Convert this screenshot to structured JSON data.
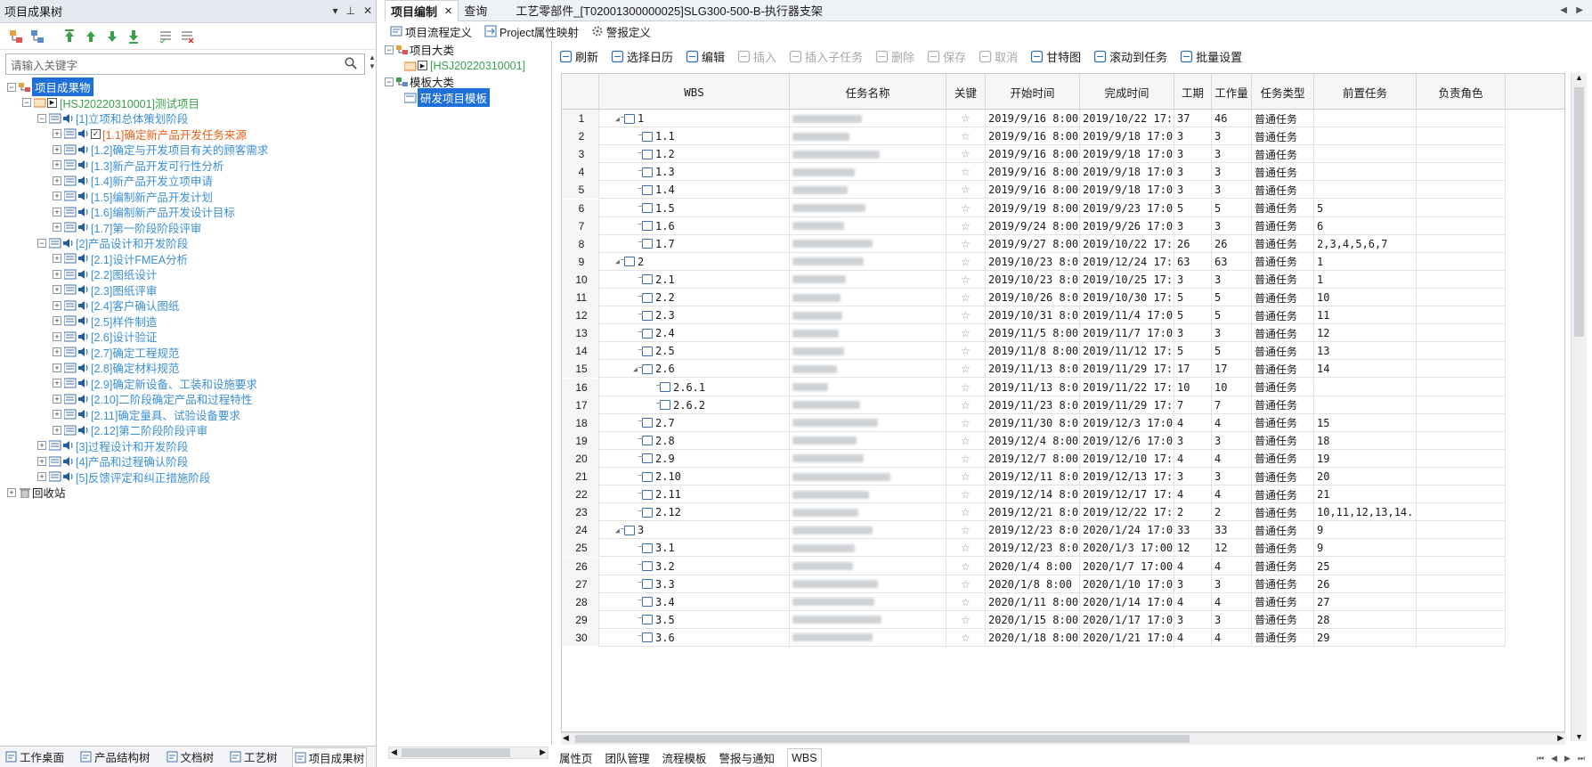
{
  "left_panel": {
    "title": "项目成果树",
    "search_placeholder": "请输入关键字",
    "tree": [
      {
        "label": "项目成果物",
        "selected": true
      },
      {
        "label": "[HSJ20220310001]测试项目",
        "color": "green"
      },
      {
        "label": "[1]立项和总体策划阶段"
      },
      {
        "label": "[1.1]确定新产品开发任务来源",
        "color": "orange"
      },
      {
        "label": "[1.2]确定与开发项目有关的顾客需求"
      },
      {
        "label": "[1.3]新产品开发可行性分析"
      },
      {
        "label": "[1.4]新产品开发立项申请"
      },
      {
        "label": "[1.5]编制新产品开发计划"
      },
      {
        "label": "[1.6]编制新产品开发设计目标"
      },
      {
        "label": "[1.7]第一阶段阶段评审"
      },
      {
        "label": "[2]产品设计和开发阶段"
      },
      {
        "label": "[2.1]设计FMEA分析"
      },
      {
        "label": "[2.2]图纸设计"
      },
      {
        "label": "[2.3]图纸评审"
      },
      {
        "label": "[2.4]客户确认图纸"
      },
      {
        "label": "[2.5]样件制造"
      },
      {
        "label": "[2.6]设计验证"
      },
      {
        "label": "[2.7]确定工程规范"
      },
      {
        "label": "[2.8]确定材料规范"
      },
      {
        "label": "[2.9]确定新设备、工装和设施要求"
      },
      {
        "label": "[2.10]二阶段确定产品和过程特性"
      },
      {
        "label": "[2.11]确定量具、试验设备要求"
      },
      {
        "label": "[2.12]第二阶段阶段评审"
      },
      {
        "label": "[3]过程设计和开发阶段"
      },
      {
        "label": "[4]产品和过程确认阶段"
      },
      {
        "label": "[5]反馈评定和纠正措施阶段"
      },
      {
        "label": "回收站"
      }
    ],
    "bottom_tabs": [
      "工作桌面",
      "产品结构树",
      "文档树",
      "工艺树",
      "项目成果树"
    ]
  },
  "tabs": {
    "items": [
      "项目编制",
      "查询"
    ],
    "title": "工艺零部件_[T02001300000025]SLG300-500-B-执行器支架"
  },
  "subtoolbar": [
    "项目流程定义",
    "Project属性映射",
    "警报定义"
  ],
  "mid_tree": [
    {
      "label": "项目大类"
    },
    {
      "label": "[HSJ20220310001]"
    },
    {
      "label": "模板大类"
    },
    {
      "label": "研发项目模板",
      "selected": true
    }
  ],
  "grid_toolbar": [
    {
      "label": "刷新",
      "enabled": true
    },
    {
      "label": "选择日历",
      "enabled": true
    },
    {
      "label": "编辑",
      "enabled": true
    },
    {
      "label": "插入",
      "enabled": false
    },
    {
      "label": "插入子任务",
      "enabled": false
    },
    {
      "label": "删除",
      "enabled": false
    },
    {
      "label": "保存",
      "enabled": false
    },
    {
      "label": "取消",
      "enabled": false
    },
    {
      "label": "甘特图",
      "enabled": true
    },
    {
      "label": "滚动到任务",
      "enabled": true
    },
    {
      "label": "批量设置",
      "enabled": true
    }
  ],
  "grid": {
    "columns": [
      "WBS",
      "任务名称",
      "关键",
      "开始时间",
      "完成时间",
      "工期",
      "工作量",
      "任务类型",
      "前置任务",
      "负责角色"
    ],
    "rows": [
      {
        "n": "1",
        "wbs": "1",
        "lvl": 0,
        "start": "2019/9/16 8:00",
        "end": "2019/10/22 17:00",
        "dur": "37",
        "work": "46",
        "type": "普通任务",
        "pred": ""
      },
      {
        "n": "2",
        "wbs": "1.1",
        "lvl": 1,
        "start": "2019/9/16 8:00",
        "end": "2019/9/18 17:00",
        "dur": "3",
        "work": "3",
        "type": "普通任务",
        "pred": ""
      },
      {
        "n": "3",
        "wbs": "1.2",
        "lvl": 1,
        "start": "2019/9/16 8:00",
        "end": "2019/9/18 17:00",
        "dur": "3",
        "work": "3",
        "type": "普通任务",
        "pred": ""
      },
      {
        "n": "4",
        "wbs": "1.3",
        "lvl": 1,
        "start": "2019/9/16 8:00",
        "end": "2019/9/18 17:00",
        "dur": "3",
        "work": "3",
        "type": "普通任务",
        "pred": ""
      },
      {
        "n": "5",
        "wbs": "1.4",
        "lvl": 1,
        "start": "2019/9/16 8:00",
        "end": "2019/9/18 17:00",
        "dur": "3",
        "work": "3",
        "type": "普通任务",
        "pred": ""
      },
      {
        "n": "6",
        "wbs": "1.5",
        "lvl": 1,
        "start": "2019/9/19 8:00",
        "end": "2019/9/23 17:00",
        "dur": "5",
        "work": "5",
        "type": "普通任务",
        "pred": "5"
      },
      {
        "n": "7",
        "wbs": "1.6",
        "lvl": 1,
        "start": "2019/9/24 8:00",
        "end": "2019/9/26 17:00",
        "dur": "3",
        "work": "3",
        "type": "普通任务",
        "pred": "6"
      },
      {
        "n": "8",
        "wbs": "1.7",
        "lvl": 1,
        "start": "2019/9/27 8:00",
        "end": "2019/10/22 17:00",
        "dur": "26",
        "work": "26",
        "type": "普通任务",
        "pred": "2,3,4,5,6,7"
      },
      {
        "n": "9",
        "wbs": "2",
        "lvl": 0,
        "start": "2019/10/23 8:00",
        "end": "2019/12/24 17:00",
        "dur": "63",
        "work": "63",
        "type": "普通任务",
        "pred": "1"
      },
      {
        "n": "10",
        "wbs": "2.1",
        "lvl": 1,
        "start": "2019/10/23 8:00",
        "end": "2019/10/25 17:00",
        "dur": "3",
        "work": "3",
        "type": "普通任务",
        "pred": "1"
      },
      {
        "n": "11",
        "wbs": "2.2",
        "lvl": 1,
        "start": "2019/10/26 8:00",
        "end": "2019/10/30 17:00",
        "dur": "5",
        "work": "5",
        "type": "普通任务",
        "pred": "10"
      },
      {
        "n": "12",
        "wbs": "2.3",
        "lvl": 1,
        "start": "2019/10/31 8:00",
        "end": "2019/11/4 17:00",
        "dur": "5",
        "work": "5",
        "type": "普通任务",
        "pred": "11"
      },
      {
        "n": "13",
        "wbs": "2.4",
        "lvl": 1,
        "start": "2019/11/5 8:00",
        "end": "2019/11/7 17:00",
        "dur": "3",
        "work": "3",
        "type": "普通任务",
        "pred": "12"
      },
      {
        "n": "14",
        "wbs": "2.5",
        "lvl": 1,
        "start": "2019/11/8 8:00",
        "end": "2019/11/12 17:00",
        "dur": "5",
        "work": "5",
        "type": "普通任务",
        "pred": "13"
      },
      {
        "n": "15",
        "wbs": "2.6",
        "lvl": 1,
        "start": "2019/11/13 8:00",
        "end": "2019/11/29 17:00",
        "dur": "17",
        "work": "17",
        "type": "普通任务",
        "pred": "14"
      },
      {
        "n": "16",
        "wbs": "2.6.1",
        "lvl": 2,
        "start": "2019/11/13 8:00",
        "end": "2019/11/22 17:00",
        "dur": "10",
        "work": "10",
        "type": "普通任务",
        "pred": ""
      },
      {
        "n": "17",
        "wbs": "2.6.2",
        "lvl": 2,
        "start": "2019/11/23 8:00",
        "end": "2019/11/29 17:00",
        "dur": "7",
        "work": "7",
        "type": "普通任务",
        "pred": ""
      },
      {
        "n": "18",
        "wbs": "2.7",
        "lvl": 1,
        "start": "2019/11/30 8:00",
        "end": "2019/12/3 17:00",
        "dur": "4",
        "work": "4",
        "type": "普通任务",
        "pred": "15"
      },
      {
        "n": "19",
        "wbs": "2.8",
        "lvl": 1,
        "start": "2019/12/4 8:00",
        "end": "2019/12/6 17:00",
        "dur": "3",
        "work": "3",
        "type": "普通任务",
        "pred": "18"
      },
      {
        "n": "20",
        "wbs": "2.9",
        "lvl": 1,
        "start": "2019/12/7 8:00",
        "end": "2019/12/10 17:00",
        "dur": "4",
        "work": "4",
        "type": "普通任务",
        "pred": "19"
      },
      {
        "n": "21",
        "wbs": "2.10",
        "lvl": 1,
        "start": "2019/12/11 8:00",
        "end": "2019/12/13 17:00",
        "dur": "3",
        "work": "3",
        "type": "普通任务",
        "pred": "20"
      },
      {
        "n": "22",
        "wbs": "2.11",
        "lvl": 1,
        "start": "2019/12/14 8:00",
        "end": "2019/12/17 17:00",
        "dur": "4",
        "work": "4",
        "type": "普通任务",
        "pred": "21"
      },
      {
        "n": "23",
        "wbs": "2.12",
        "lvl": 1,
        "start": "2019/12/21 8:00",
        "end": "2019/12/22 17:00",
        "dur": "2",
        "work": "2",
        "type": "普通任务",
        "pred": "10,11,12,13,14..."
      },
      {
        "n": "24",
        "wbs": "3",
        "lvl": 0,
        "start": "2019/12/23 8:00",
        "end": "2020/1/24 17:00",
        "dur": "33",
        "work": "33",
        "type": "普通任务",
        "pred": "9"
      },
      {
        "n": "25",
        "wbs": "3.1",
        "lvl": 1,
        "start": "2019/12/23 8:00",
        "end": "2020/1/3 17:00",
        "dur": "12",
        "work": "12",
        "type": "普通任务",
        "pred": "9"
      },
      {
        "n": "26",
        "wbs": "3.2",
        "lvl": 1,
        "start": "2020/1/4 8:00",
        "end": "2020/1/7 17:00",
        "dur": "4",
        "work": "4",
        "type": "普通任务",
        "pred": "25"
      },
      {
        "n": "27",
        "wbs": "3.3",
        "lvl": 1,
        "start": "2020/1/8 8:00",
        "end": "2020/1/10 17:00",
        "dur": "3",
        "work": "3",
        "type": "普通任务",
        "pred": "26"
      },
      {
        "n": "28",
        "wbs": "3.4",
        "lvl": 1,
        "start": "2020/1/11 8:00",
        "end": "2020/1/14 17:00",
        "dur": "4",
        "work": "4",
        "type": "普通任务",
        "pred": "27"
      },
      {
        "n": "29",
        "wbs": "3.5",
        "lvl": 1,
        "start": "2020/1/15 8:00",
        "end": "2020/1/17 17:00",
        "dur": "3",
        "work": "3",
        "type": "普通任务",
        "pred": "28"
      },
      {
        "n": "30",
        "wbs": "3.6",
        "lvl": 1,
        "start": "2020/1/18 8:00",
        "end": "2020/1/21 17:00",
        "dur": "4",
        "work": "4",
        "type": "普通任务",
        "pred": "29"
      }
    ]
  },
  "bottom_tabs_right": [
    "属性页",
    "团队管理",
    "流程模板",
    "警报与通知",
    "WBS"
  ]
}
